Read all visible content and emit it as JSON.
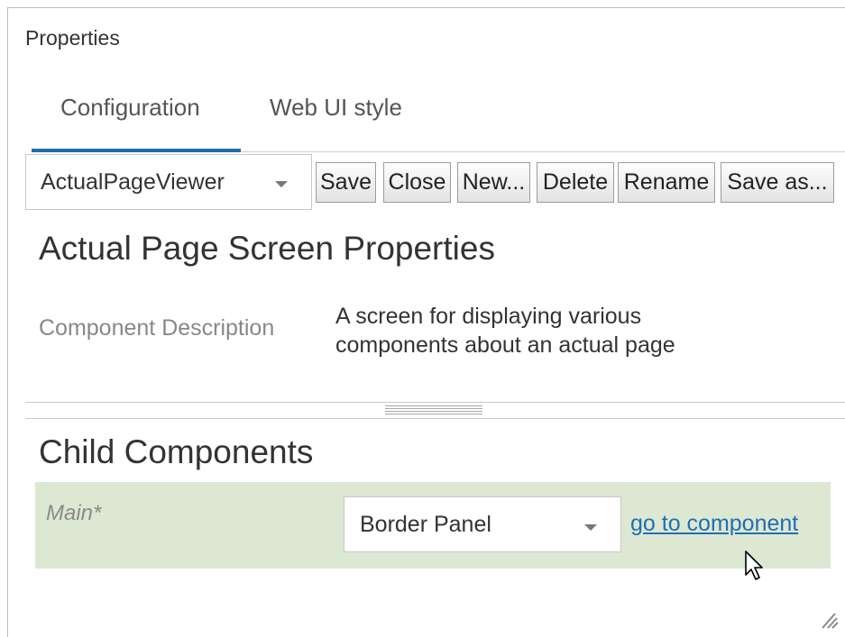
{
  "window": {
    "title": "Properties"
  },
  "tabs": [
    {
      "label": "Configuration",
      "active": true
    },
    {
      "label": "Web UI style",
      "active": false
    }
  ],
  "toolbar": {
    "component_select": {
      "value": "ActualPageViewer"
    },
    "buttons": [
      "Save",
      "Close",
      "New...",
      "Delete",
      "Rename",
      "Save as..."
    ]
  },
  "properties": {
    "title": "Actual Page Screen Properties",
    "description_label": "Component Description",
    "description_line1": "A screen for displaying various",
    "description_line2": "components about an actual page"
  },
  "child_components": {
    "title": "Child Components",
    "rows": [
      {
        "label": "Main*",
        "select_value": "Border Panel",
        "link_text": "go to component"
      }
    ]
  },
  "colors": {
    "accent": "#1f6ea8",
    "row_background": "#dde8d3",
    "link": "#1f6fb2"
  }
}
